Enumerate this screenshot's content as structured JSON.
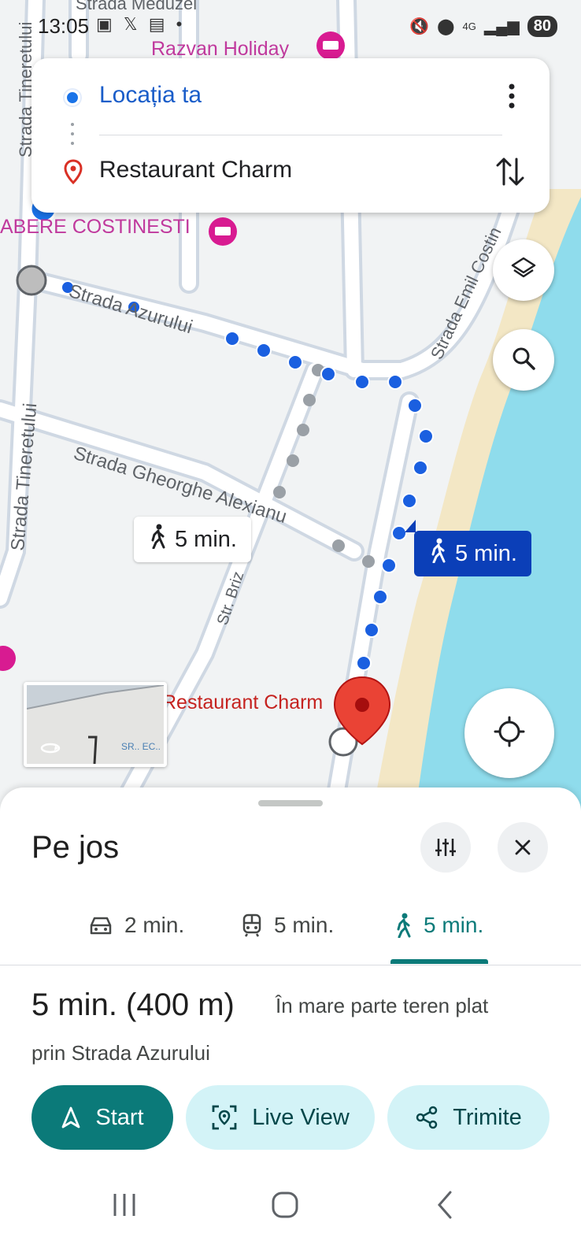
{
  "status_bar": {
    "time": "13:05",
    "network": "4G",
    "battery": "80"
  },
  "route": {
    "origin": "Locația ta",
    "destination": "Restaurant Charm"
  },
  "map": {
    "streets": [
      "Strada Azurului",
      "Strada Gheorghe Alexianu",
      "Strada Tineretului",
      "Strada Tineretului",
      "Strada Emil Costin",
      "Str. Briz",
      "Strada Meduzei"
    ],
    "pois": [
      "Razvan Holiday",
      "ABERE COSTINESTI"
    ],
    "destination_label": "Restaurant Charm",
    "route_bubbles": [
      {
        "time": "5 min.",
        "selected": false
      },
      {
        "time": "5 min.",
        "selected": true
      }
    ]
  },
  "sheet": {
    "mode_title": "Pe jos",
    "tabs": [
      {
        "mode": "driving",
        "time": "2 min.",
        "active": false
      },
      {
        "mode": "transit",
        "time": "5 min.",
        "active": false
      },
      {
        "mode": "walking",
        "time": "5 min.",
        "active": true
      }
    ],
    "summary_time": "5 min. (400 m)",
    "summary_note": "În mare parte teren plat",
    "via": "prin Strada Azurului",
    "actions": {
      "start": "Start",
      "live_view": "Live View",
      "share": "Trimite"
    }
  },
  "colors": {
    "accent_teal": "#0b7a79",
    "route_blue": "#1a5fe0",
    "water": "#8fdcec",
    "sand": "#f3e7c5",
    "poi_pink": "#c0399d"
  }
}
